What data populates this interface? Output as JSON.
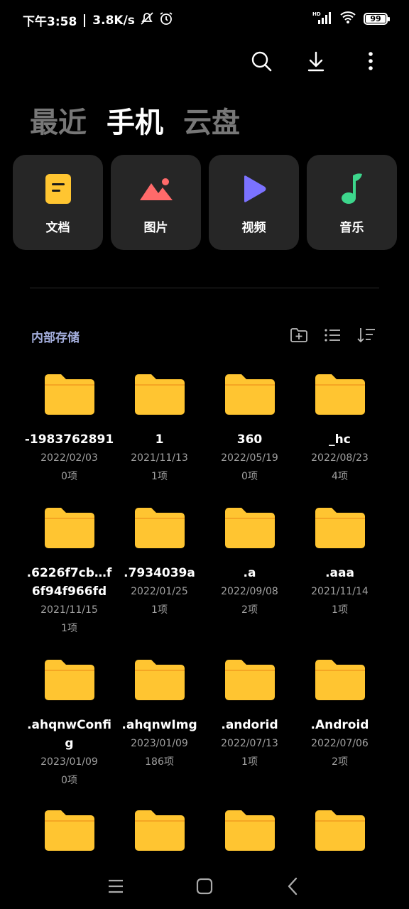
{
  "status": {
    "time": "下午3:58",
    "speed": "3.8K/s",
    "battery": "99",
    "battery_level": 0.99,
    "network": "HD"
  },
  "toolbar": {
    "search_icon": "search-icon",
    "download_icon": "download-icon",
    "more_icon": "more-vert-icon"
  },
  "tabs": [
    {
      "label": "最近",
      "active": false
    },
    {
      "label": "手机",
      "active": true
    },
    {
      "label": "云盘",
      "active": false
    }
  ],
  "categories": [
    {
      "label": "文档",
      "icon": "document-icon",
      "color": "#FFC531"
    },
    {
      "label": "图片",
      "icon": "image-icon",
      "color": "#FF6A6A"
    },
    {
      "label": "视频",
      "icon": "video-icon",
      "color": "#7B72FF"
    },
    {
      "label": "音乐",
      "icon": "music-icon",
      "color": "#3DD68C"
    }
  ],
  "section": {
    "title": "内部存储"
  },
  "folders": [
    {
      "name": "-1983762891",
      "date": "2022/02/03",
      "count": "0项"
    },
    {
      "name": "1",
      "date": "2021/11/13",
      "count": "1项"
    },
    {
      "name": "360",
      "date": "2022/05/19",
      "count": "0项"
    },
    {
      "name": "_hc",
      "date": "2022/08/23",
      "count": "4项"
    },
    {
      "name": ".6226f7cb…f6f94f966fd",
      "date": "2021/11/15",
      "count": "1项"
    },
    {
      "name": ".7934039a",
      "date": "2022/01/25",
      "count": "1项"
    },
    {
      "name": ".a",
      "date": "2022/09/08",
      "count": "2项"
    },
    {
      "name": ".aaa",
      "date": "2021/11/14",
      "count": "1项"
    },
    {
      "name": ".ahqnwConfig",
      "date": "2023/01/09",
      "count": "0项"
    },
    {
      "name": ".ahqnwImg",
      "date": "2023/01/09",
      "count": "186项"
    },
    {
      "name": ".andorid",
      "date": "2022/07/13",
      "count": "1项"
    },
    {
      "name": ".Android",
      "date": "2022/07/06",
      "count": "2项"
    },
    {
      "name": "",
      "date": "",
      "count": ""
    },
    {
      "name": "",
      "date": "",
      "count": ""
    },
    {
      "name": "",
      "date": "",
      "count": ""
    },
    {
      "name": "",
      "date": "",
      "count": ""
    }
  ],
  "colors": {
    "folder": "#FFC531",
    "folder_tab": "#F5A623",
    "accent": "#A4AEDC"
  }
}
